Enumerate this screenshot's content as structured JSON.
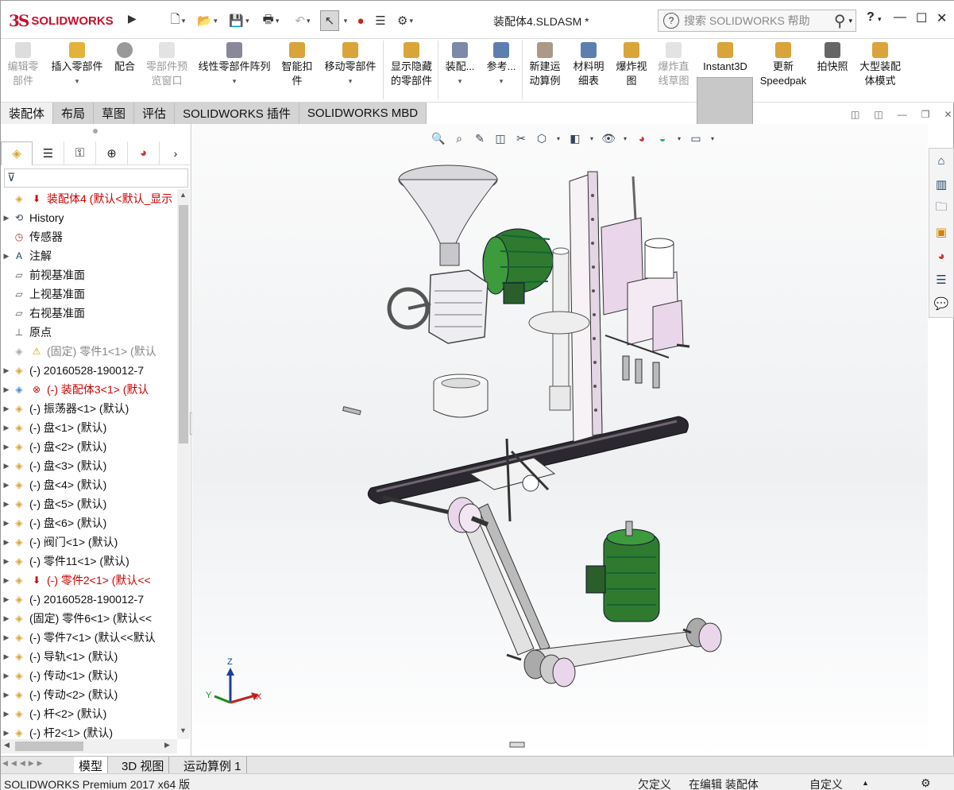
{
  "app": {
    "brand_mark": "3S",
    "brand_name": "SOLIDWORKS",
    "doc_title": "装配体4.SLDASM *"
  },
  "search": {
    "placeholder": "搜索 SOLIDWORKS 帮助"
  },
  "titlebar_controls": {
    "help": "?",
    "minimize": "—",
    "maximize": "☐",
    "close": "✕"
  },
  "ribbon": [
    {
      "label": "编辑零部件",
      "disabled": true
    },
    {
      "label": "插入零部件",
      "disabled": false
    },
    {
      "label": "配合",
      "disabled": false
    },
    {
      "label": "零部件预览窗口",
      "disabled": true
    },
    {
      "label": "线性零部件阵列",
      "disabled": false
    },
    {
      "label": "智能扣件",
      "disabled": false
    },
    {
      "label": "移动零部件",
      "disabled": false
    },
    {
      "label": "显示隐藏的零部件",
      "disabled": false
    },
    {
      "label": "装配...",
      "disabled": false
    },
    {
      "label": "参考...",
      "disabled": false
    },
    {
      "label": "新建运动算例",
      "disabled": false
    },
    {
      "label": "材料明细表",
      "disabled": false
    },
    {
      "label": "爆炸视图",
      "disabled": false
    },
    {
      "label": "爆炸直线草图",
      "disabled": true
    },
    {
      "label": "Instant3D",
      "disabled": false
    },
    {
      "label": "更新Speedpak",
      "disabled": false
    },
    {
      "label": "拍快照",
      "disabled": false
    },
    {
      "label": "大型装配体模式",
      "disabled": false
    }
  ],
  "tabs": [
    "装配体",
    "布局",
    "草图",
    "评估",
    "SOLIDWORKS 插件",
    "SOLIDWORKS MBD"
  ],
  "tree": [
    {
      "label": "装配体4  (默认<默认_显示",
      "kind": "root-error",
      "exp": ""
    },
    {
      "label": "History",
      "kind": "history",
      "exp": "▶"
    },
    {
      "label": "传感器",
      "kind": "sensor",
      "exp": ""
    },
    {
      "label": "注解",
      "kind": "annotation",
      "exp": "▶"
    },
    {
      "label": "前视基准面",
      "kind": "plane",
      "exp": ""
    },
    {
      "label": "上视基准面",
      "kind": "plane",
      "exp": ""
    },
    {
      "label": "右视基准面",
      "kind": "plane",
      "exp": ""
    },
    {
      "label": "原点",
      "kind": "origin",
      "exp": ""
    },
    {
      "label": "(固定) 零件1<1> (默认",
      "kind": "part-warn",
      "exp": ""
    },
    {
      "label": "(-) 20160528-190012-7",
      "kind": "part",
      "exp": "▶"
    },
    {
      "label": "(-) 装配体3<1> (默认",
      "kind": "asm-error",
      "exp": "▶"
    },
    {
      "label": "(-) 振荡器<1> (默认)",
      "kind": "part",
      "exp": "▶"
    },
    {
      "label": "(-) 盘<1> (默认)",
      "kind": "part",
      "exp": "▶"
    },
    {
      "label": "(-) 盘<2> (默认)",
      "kind": "part",
      "exp": "▶"
    },
    {
      "label": "(-) 盘<3> (默认)",
      "kind": "part",
      "exp": "▶"
    },
    {
      "label": "(-) 盘<4> (默认)",
      "kind": "part",
      "exp": "▶"
    },
    {
      "label": "(-) 盘<5> (默认)",
      "kind": "part",
      "exp": "▶"
    },
    {
      "label": "(-) 盘<6> (默认)",
      "kind": "part",
      "exp": "▶"
    },
    {
      "label": "(-) 阀门<1> (默认)",
      "kind": "part",
      "exp": "▶"
    },
    {
      "label": "(-) 零件11<1> (默认)",
      "kind": "part",
      "exp": "▶"
    },
    {
      "label": "(-) 零件2<1> (默认<<",
      "kind": "part-error",
      "exp": "▶"
    },
    {
      "label": "(-) 20160528-190012-7",
      "kind": "part",
      "exp": "▶"
    },
    {
      "label": "(固定) 零件6<1> (默认<<",
      "kind": "part",
      "exp": "▶"
    },
    {
      "label": "(-) 零件7<1> (默认<<默认",
      "kind": "part",
      "exp": "▶"
    },
    {
      "label": "(-) 导轨<1> (默认)",
      "kind": "part",
      "exp": "▶"
    },
    {
      "label": "(-) 传动<1> (默认)",
      "kind": "part",
      "exp": "▶"
    },
    {
      "label": "(-) 传动<2> (默认)",
      "kind": "part",
      "exp": "▶"
    },
    {
      "label": "(-) 杆<2> (默认)",
      "kind": "part",
      "exp": "▶"
    },
    {
      "label": "(-) 杆2<1> (默认)",
      "kind": "part",
      "exp": "▶"
    }
  ],
  "triad": {
    "x": "X",
    "y": "Y",
    "z": "Z"
  },
  "bottom_tabs": [
    "模型",
    "3D 视图",
    "运动算例 1"
  ],
  "status": {
    "product": "SOLIDWORKS Premium 2017 x64 版",
    "defined": "欠定义",
    "mode": "在编辑 装配体",
    "custom": "自定义",
    "caret": "▲"
  },
  "colors": {
    "brand": "#c8102e",
    "error": "#cc0000",
    "motor": "#2f7a2f",
    "accent_pink": "#ead6ea",
    "belt": "#2b2830"
  }
}
